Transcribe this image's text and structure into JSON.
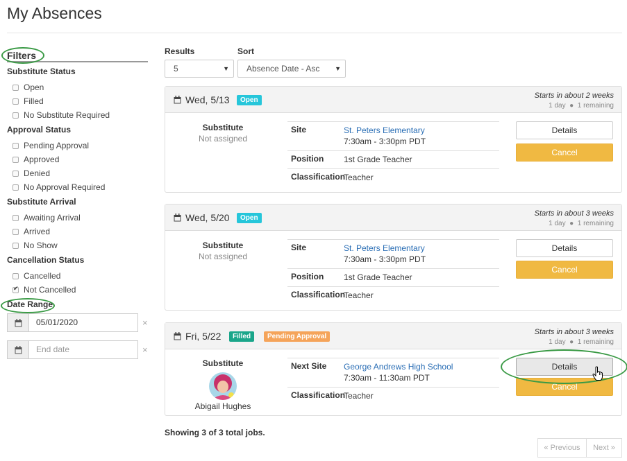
{
  "page": {
    "title": "My Absences"
  },
  "filters": {
    "title": "Filters",
    "groups": [
      {
        "title": "Substitute Status",
        "items": [
          {
            "label": "Open",
            "checked": false
          },
          {
            "label": "Filled",
            "checked": false
          },
          {
            "label": "No Substitute Required",
            "checked": false
          }
        ]
      },
      {
        "title": "Approval Status",
        "items": [
          {
            "label": "Pending Approval",
            "checked": false
          },
          {
            "label": "Approved",
            "checked": false
          },
          {
            "label": "Denied",
            "checked": false
          },
          {
            "label": "No Approval Required",
            "checked": false
          }
        ]
      },
      {
        "title": "Substitute Arrival",
        "items": [
          {
            "label": "Awaiting Arrival",
            "checked": false
          },
          {
            "label": "Arrived",
            "checked": false
          },
          {
            "label": "No Show",
            "checked": false
          }
        ]
      },
      {
        "title": "Cancellation Status",
        "items": [
          {
            "label": "Cancelled",
            "checked": false
          },
          {
            "label": "Not Cancelled",
            "checked": true
          }
        ]
      }
    ],
    "date_range": {
      "title": "Date Range",
      "start_value": "05/01/2020",
      "end_placeholder": "End date",
      "clear_symbol": "×"
    }
  },
  "controls": {
    "results_label": "Results",
    "results_value": "5",
    "sort_label": "Sort",
    "sort_value": "Absence Date - Asc"
  },
  "labels": {
    "substitute": "Substitute",
    "site": "Site",
    "next_site": "Next Site",
    "position": "Position",
    "classification": "Classification",
    "details": "Details",
    "cancel": "Cancel"
  },
  "jobs": [
    {
      "date": "Wed, 5/13",
      "badges": [
        "Open"
      ],
      "starts": "Starts in about 2 weeks",
      "duration": "1 day",
      "remaining": "1 remaining",
      "substitute": "Not assigned",
      "site": "St. Peters Elementary",
      "time": "7:30am - 3:30pm PDT",
      "position": "1st Grade Teacher",
      "classification": "Teacher"
    },
    {
      "date": "Wed, 5/20",
      "badges": [
        "Open"
      ],
      "starts": "Starts in about 3 weeks",
      "duration": "1 day",
      "remaining": "1 remaining",
      "substitute": "Not assigned",
      "site": "St. Peters Elementary",
      "time": "7:30am - 3:30pm PDT",
      "position": "1st Grade Teacher",
      "classification": "Teacher"
    },
    {
      "date": "Fri, 5/22",
      "badges": [
        "Filled",
        "Pending Approval"
      ],
      "starts": "Starts in about 3 weeks",
      "duration": "1 day",
      "remaining": "1 remaining",
      "substitute": "Abigail Hughes",
      "site": "George Andrews High School",
      "time": "7:30am - 11:30am PDT",
      "classification": "Teacher"
    }
  ],
  "summary": "Showing 3 of 3 total jobs.",
  "pager": {
    "previous": "« Previous",
    "next": "Next »"
  },
  "colors": {
    "accent": "#f0b942",
    "open": "#26c6da",
    "filled": "#1aa68a",
    "pending": "#f5a45a",
    "highlight": "#3a9a45"
  }
}
